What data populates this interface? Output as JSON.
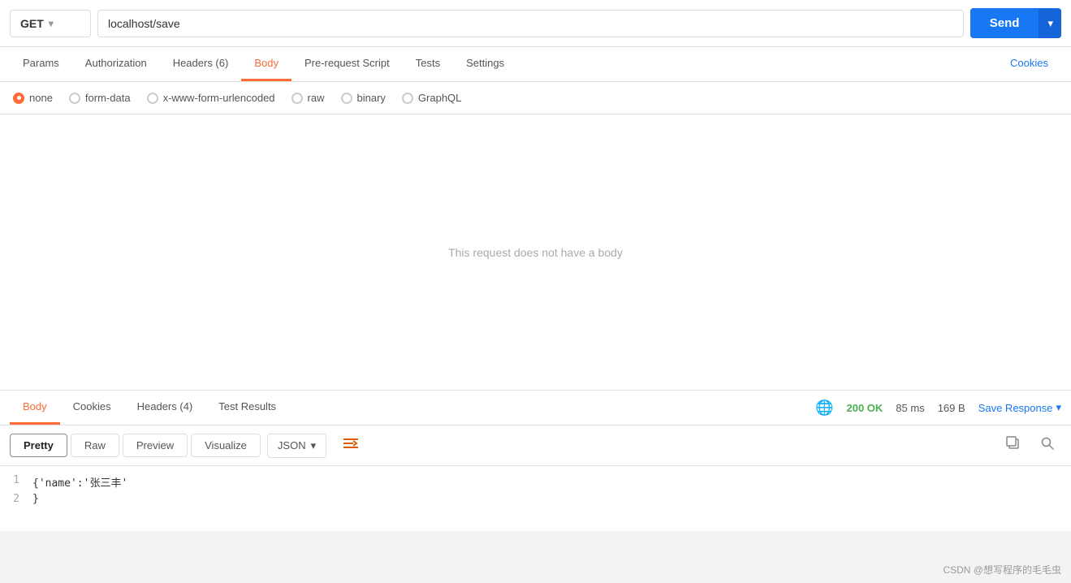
{
  "url_bar": {
    "method": "GET",
    "url": "localhost/save",
    "send_label": "Send",
    "chevron": "▾"
  },
  "req_tabs": [
    {
      "id": "params",
      "label": "Params",
      "active": false
    },
    {
      "id": "authorization",
      "label": "Authorization",
      "active": false
    },
    {
      "id": "headers",
      "label": "Headers (6)",
      "active": false
    },
    {
      "id": "body",
      "label": "Body",
      "active": true
    },
    {
      "id": "pre-request",
      "label": "Pre-request Script",
      "active": false
    },
    {
      "id": "tests",
      "label": "Tests",
      "active": false
    },
    {
      "id": "settings",
      "label": "Settings",
      "active": false
    },
    {
      "id": "cookies",
      "label": "Cookies",
      "active": false,
      "is_right": true
    }
  ],
  "body_options": [
    {
      "id": "none",
      "label": "none",
      "active": true
    },
    {
      "id": "form-data",
      "label": "form-data",
      "active": false
    },
    {
      "id": "x-www-form-urlencoded",
      "label": "x-www-form-urlencoded",
      "active": false
    },
    {
      "id": "raw",
      "label": "raw",
      "active": false
    },
    {
      "id": "binary",
      "label": "binary",
      "active": false
    },
    {
      "id": "graphql",
      "label": "GraphQL",
      "active": false
    }
  ],
  "no_body_message": "This request does not have a body",
  "resp_tabs": [
    {
      "id": "body",
      "label": "Body",
      "active": true
    },
    {
      "id": "cookies",
      "label": "Cookies",
      "active": false
    },
    {
      "id": "headers",
      "label": "Headers (4)",
      "active": false
    },
    {
      "id": "test-results",
      "label": "Test Results",
      "active": false
    }
  ],
  "resp_status": {
    "status_code": "200 OK",
    "time": "85 ms",
    "size": "169 B",
    "save_response": "Save Response",
    "chevron": "▾"
  },
  "resp_toolbar": {
    "formats": [
      "Pretty",
      "Raw",
      "Preview",
      "Visualize"
    ],
    "active_format": "Pretty",
    "json_label": "JSON",
    "wrap_icon": "≡",
    "copy_icon": "⧉",
    "search_icon": "🔍"
  },
  "code_lines": [
    {
      "num": "1",
      "content": "{'name':'张三丰'"
    },
    {
      "num": "2",
      "content": "}"
    }
  ],
  "watermark": "CSDN @想写程序的毛毛虫"
}
